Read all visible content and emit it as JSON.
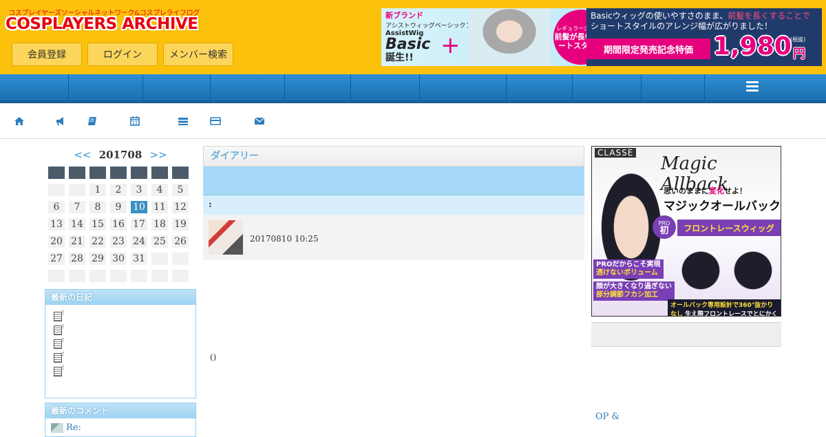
{
  "header": {
    "logo_tagline": "コスプレイヤーズソーシャルネットワーク&コスプレライフログ",
    "logo_text": "COSPLAYERS ARCHIVE",
    "buttons": [
      "会員登録",
      "ログイン",
      "メンバー検索"
    ]
  },
  "banner": {
    "new_brand": "新ブランド",
    "subtitle": "アシストウィッグベーシックプラス",
    "brand": "AssistWig",
    "product": "Basic",
    "plus": "+",
    "born": "誕生!!",
    "circle_small": "レギュラーショート",
    "circle_text": "前髪が長いショートスタイル",
    "message_before": "Basicウィッグの使いやすさのまま、",
    "message_highlight": "前髪を長くすることで",
    "message_after": "ショートスタイルのアレンジ幅が広がりました！",
    "promo": "期間限定発売記念特価",
    "price": "1,980",
    "yen": "円",
    "tax": "(税抜)"
  },
  "icons": [
    "home-icon",
    "bullhorn-icon",
    "book-icon",
    "calendar-icon",
    "list-icon",
    "credit-card-icon",
    "envelope-icon"
  ],
  "calendar": {
    "prev": "<<",
    "month": "201708",
    "next": ">>",
    "weeks": [
      [
        "",
        "",
        "1",
        "2",
        "3",
        "4",
        "5"
      ],
      [
        "6",
        "7",
        "8",
        "9",
        "10",
        "11",
        "12"
      ],
      [
        "13",
        "14",
        "15",
        "16",
        "17",
        "18",
        "19"
      ],
      [
        "20",
        "21",
        "22",
        "23",
        "24",
        "25",
        "26"
      ],
      [
        "27",
        "28",
        "29",
        "30",
        "31",
        "",
        ""
      ],
      [
        "",
        "",
        "",
        "",
        "",
        "",
        ""
      ]
    ],
    "today": "10"
  },
  "recent_diary": {
    "title": "最新の日記",
    "items": [
      "",
      "",
      "",
      "",
      ""
    ]
  },
  "recent_comments": {
    "title": "最新のコメント",
    "items": [
      "Re:"
    ]
  },
  "main": {
    "title": "ダイアリー",
    "subtitle": ":",
    "entry_date": "20170810 10:25",
    "footer_parens": "()"
  },
  "right_ad": {
    "brand": "CLASSE",
    "script": "Magic Allback",
    "copy_before": "思いのままに",
    "copy_highlight": "変化",
    "copy_after": "せよ！",
    "title": "マジックオールバック",
    "pro_label": "PRO",
    "pro_char": "初",
    "front": "フロントレースウィッグ",
    "tag1_top": "PROだからこそ実現",
    "tag1_bottom": "透けないボリューム",
    "tag2_top": "顔が大きくなり過ぎない",
    "tag2_bottom": "部分調節フカシ加工",
    "bottom_left": "オールバック専用設計で360°抜かりなし",
    "bottom_right": "生え際フロントレースでとにかく自然"
  },
  "right_link": "OP &"
}
